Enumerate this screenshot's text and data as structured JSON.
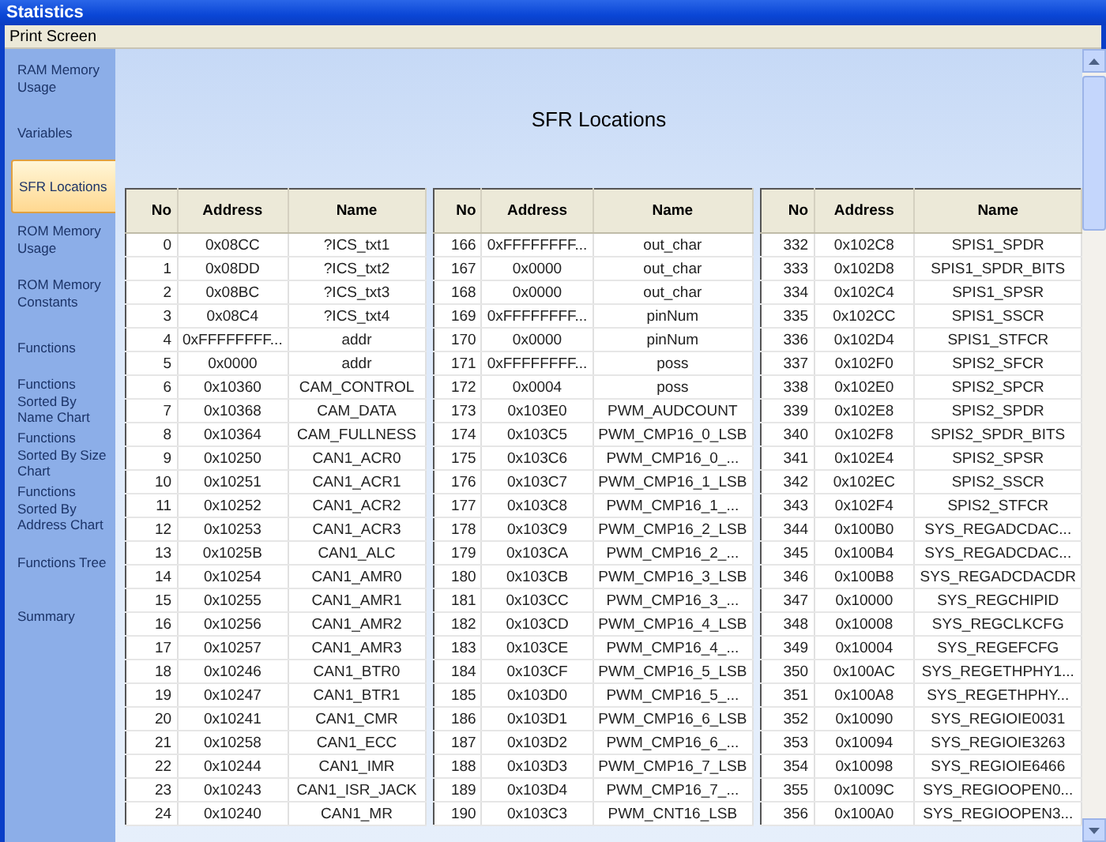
{
  "window": {
    "title": "Statistics"
  },
  "menu": [
    "Print Screen"
  ],
  "sidebar": {
    "items": [
      {
        "label": "RAM Memory Usage",
        "selected": false
      },
      {
        "label": "Variables",
        "selected": false
      },
      {
        "label": "SFR Locations",
        "selected": true
      },
      {
        "label": "ROM Memory Usage",
        "selected": false
      },
      {
        "label": "ROM Memory Constants",
        "selected": false
      },
      {
        "label": "Functions",
        "selected": false
      },
      {
        "label": "Functions Sorted By Name Chart",
        "selected": false
      },
      {
        "label": "Functions Sorted By Size Chart",
        "selected": false
      },
      {
        "label": "Functions Sorted By Address Chart",
        "selected": false
      },
      {
        "label": "Functions Tree",
        "selected": false
      },
      {
        "label": "Summary",
        "selected": false
      }
    ]
  },
  "heading": "SFR Locations",
  "tables": [
    {
      "columns": [
        "No",
        "Address",
        "Name"
      ],
      "rows": [
        {
          "no": "0",
          "address": "0x08CC",
          "name": "?ICS_txt1"
        },
        {
          "no": "1",
          "address": "0x08DD",
          "name": "?ICS_txt2"
        },
        {
          "no": "2",
          "address": "0x08BC",
          "name": "?ICS_txt3"
        },
        {
          "no": "3",
          "address": "0x08C4",
          "name": "?ICS_txt4"
        },
        {
          "no": "4",
          "address": "0xFFFFFFFF...",
          "name": "addr"
        },
        {
          "no": "5",
          "address": "0x0000",
          "name": "addr"
        },
        {
          "no": "6",
          "address": "0x10360",
          "name": "CAM_CONTROL"
        },
        {
          "no": "7",
          "address": "0x10368",
          "name": "CAM_DATA"
        },
        {
          "no": "8",
          "address": "0x10364",
          "name": "CAM_FULLNESS"
        },
        {
          "no": "9",
          "address": "0x10250",
          "name": "CAN1_ACR0"
        },
        {
          "no": "10",
          "address": "0x10251",
          "name": "CAN1_ACR1"
        },
        {
          "no": "11",
          "address": "0x10252",
          "name": "CAN1_ACR2"
        },
        {
          "no": "12",
          "address": "0x10253",
          "name": "CAN1_ACR3"
        },
        {
          "no": "13",
          "address": "0x1025B",
          "name": "CAN1_ALC"
        },
        {
          "no": "14",
          "address": "0x10254",
          "name": "CAN1_AMR0"
        },
        {
          "no": "15",
          "address": "0x10255",
          "name": "CAN1_AMR1"
        },
        {
          "no": "16",
          "address": "0x10256",
          "name": "CAN1_AMR2"
        },
        {
          "no": "17",
          "address": "0x10257",
          "name": "CAN1_AMR3"
        },
        {
          "no": "18",
          "address": "0x10246",
          "name": "CAN1_BTR0"
        },
        {
          "no": "19",
          "address": "0x10247",
          "name": "CAN1_BTR1"
        },
        {
          "no": "20",
          "address": "0x10241",
          "name": "CAN1_CMR"
        },
        {
          "no": "21",
          "address": "0x10258",
          "name": "CAN1_ECC"
        },
        {
          "no": "22",
          "address": "0x10244",
          "name": "CAN1_IMR"
        },
        {
          "no": "23",
          "address": "0x10243",
          "name": "CAN1_ISR_JACK"
        },
        {
          "no": "24",
          "address": "0x10240",
          "name": "CAN1_MR"
        }
      ]
    },
    {
      "columns": [
        "No",
        "Address",
        "Name"
      ],
      "rows": [
        {
          "no": "166",
          "address": "0xFFFFFFFF...",
          "name": "out_char"
        },
        {
          "no": "167",
          "address": "0x0000",
          "name": "out_char"
        },
        {
          "no": "168",
          "address": "0x0000",
          "name": "out_char"
        },
        {
          "no": "169",
          "address": "0xFFFFFFFF...",
          "name": "pinNum"
        },
        {
          "no": "170",
          "address": "0x0000",
          "name": "pinNum"
        },
        {
          "no": "171",
          "address": "0xFFFFFFFF...",
          "name": "poss"
        },
        {
          "no": "172",
          "address": "0x0004",
          "name": "poss"
        },
        {
          "no": "173",
          "address": "0x103E0",
          "name": "PWM_AUDCOUNT"
        },
        {
          "no": "174",
          "address": "0x103C5",
          "name": "PWM_CMP16_0_LSB"
        },
        {
          "no": "175",
          "address": "0x103C6",
          "name": "PWM_CMP16_0_..."
        },
        {
          "no": "176",
          "address": "0x103C7",
          "name": "PWM_CMP16_1_LSB"
        },
        {
          "no": "177",
          "address": "0x103C8",
          "name": "PWM_CMP16_1_..."
        },
        {
          "no": "178",
          "address": "0x103C9",
          "name": "PWM_CMP16_2_LSB"
        },
        {
          "no": "179",
          "address": "0x103CA",
          "name": "PWM_CMP16_2_..."
        },
        {
          "no": "180",
          "address": "0x103CB",
          "name": "PWM_CMP16_3_LSB"
        },
        {
          "no": "181",
          "address": "0x103CC",
          "name": "PWM_CMP16_3_..."
        },
        {
          "no": "182",
          "address": "0x103CD",
          "name": "PWM_CMP16_4_LSB"
        },
        {
          "no": "183",
          "address": "0x103CE",
          "name": "PWM_CMP16_4_..."
        },
        {
          "no": "184",
          "address": "0x103CF",
          "name": "PWM_CMP16_5_LSB"
        },
        {
          "no": "185",
          "address": "0x103D0",
          "name": "PWM_CMP16_5_..."
        },
        {
          "no": "186",
          "address": "0x103D1",
          "name": "PWM_CMP16_6_LSB"
        },
        {
          "no": "187",
          "address": "0x103D2",
          "name": "PWM_CMP16_6_..."
        },
        {
          "no": "188",
          "address": "0x103D3",
          "name": "PWM_CMP16_7_LSB"
        },
        {
          "no": "189",
          "address": "0x103D4",
          "name": "PWM_CMP16_7_..."
        },
        {
          "no": "190",
          "address": "0x103C3",
          "name": "PWM_CNT16_LSB"
        }
      ]
    },
    {
      "columns": [
        "No",
        "Address",
        "Name"
      ],
      "rows": [
        {
          "no": "332",
          "address": "0x102C8",
          "name": "SPIS1_SPDR"
        },
        {
          "no": "333",
          "address": "0x102D8",
          "name": "SPIS1_SPDR_BITS"
        },
        {
          "no": "334",
          "address": "0x102C4",
          "name": "SPIS1_SPSR"
        },
        {
          "no": "335",
          "address": "0x102CC",
          "name": "SPIS1_SSCR"
        },
        {
          "no": "336",
          "address": "0x102D4",
          "name": "SPIS1_STFCR"
        },
        {
          "no": "337",
          "address": "0x102F0",
          "name": "SPIS2_SFCR"
        },
        {
          "no": "338",
          "address": "0x102E0",
          "name": "SPIS2_SPCR"
        },
        {
          "no": "339",
          "address": "0x102E8",
          "name": "SPIS2_SPDR"
        },
        {
          "no": "340",
          "address": "0x102F8",
          "name": "SPIS2_SPDR_BITS"
        },
        {
          "no": "341",
          "address": "0x102E4",
          "name": "SPIS2_SPSR"
        },
        {
          "no": "342",
          "address": "0x102EC",
          "name": "SPIS2_SSCR"
        },
        {
          "no": "343",
          "address": "0x102F4",
          "name": "SPIS2_STFCR"
        },
        {
          "no": "344",
          "address": "0x100B0",
          "name": "SYS_REGADCDAC..."
        },
        {
          "no": "345",
          "address": "0x100B4",
          "name": "SYS_REGADCDAC..."
        },
        {
          "no": "346",
          "address": "0x100B8",
          "name": "SYS_REGADCDACDR"
        },
        {
          "no": "347",
          "address": "0x10000",
          "name": "SYS_REGCHIPID"
        },
        {
          "no": "348",
          "address": "0x10008",
          "name": "SYS_REGCLKCFG"
        },
        {
          "no": "349",
          "address": "0x10004",
          "name": "SYS_REGEFCFG"
        },
        {
          "no": "350",
          "address": "0x100AC",
          "name": "SYS_REGETHPHY1..."
        },
        {
          "no": "351",
          "address": "0x100A8",
          "name": "SYS_REGETHPHY..."
        },
        {
          "no": "352",
          "address": "0x10090",
          "name": "SYS_REGIOIE0031"
        },
        {
          "no": "353",
          "address": "0x10094",
          "name": "SYS_REGIOIE3263"
        },
        {
          "no": "354",
          "address": "0x10098",
          "name": "SYS_REGIOIE6466"
        },
        {
          "no": "355",
          "address": "0x1009C",
          "name": "SYS_REGIOOPEN0..."
        },
        {
          "no": "356",
          "address": "0x100A0",
          "name": "SYS_REGIOOPEN3..."
        }
      ]
    }
  ]
}
